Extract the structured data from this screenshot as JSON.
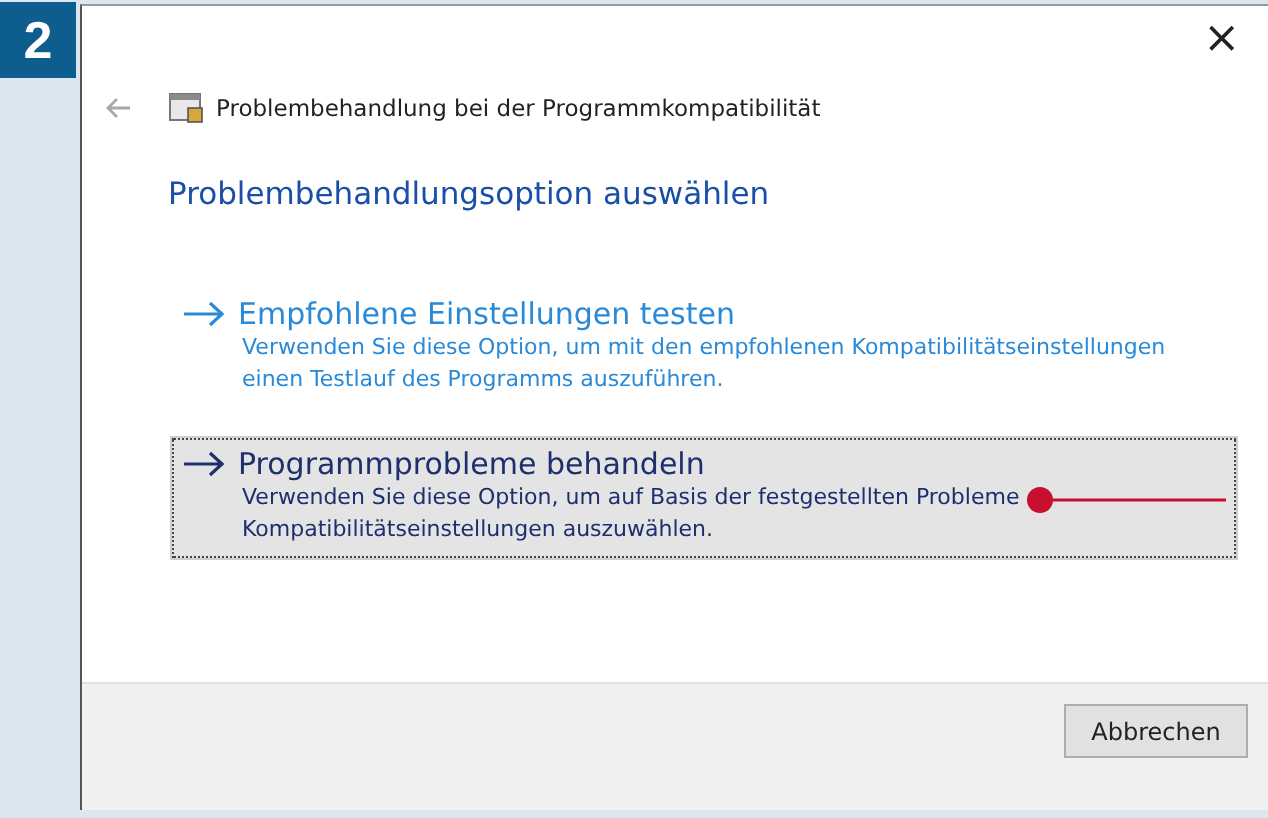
{
  "step_badge": "2",
  "window": {
    "title": "Problembehandlung bei der Programmkompatibilität",
    "close": "×"
  },
  "heading": "Problembehandlungsoption auswählen",
  "options": [
    {
      "title": "Empfohlene Einstellungen testen",
      "description": "Verwenden Sie diese Option, um mit den empfohlenen Kompatibilitätseinstellungen einen Testlauf des Programms auszuführen.",
      "selected": false,
      "annotated": false
    },
    {
      "title": "Programmprobleme behandeln",
      "description": "Verwenden Sie diese Option, um auf Basis der festgestellten Probleme Kompatibilitätseinstellungen auszuwählen.",
      "selected": true,
      "annotated": true
    }
  ],
  "buttons": [
    "Abbrechen"
  ]
}
